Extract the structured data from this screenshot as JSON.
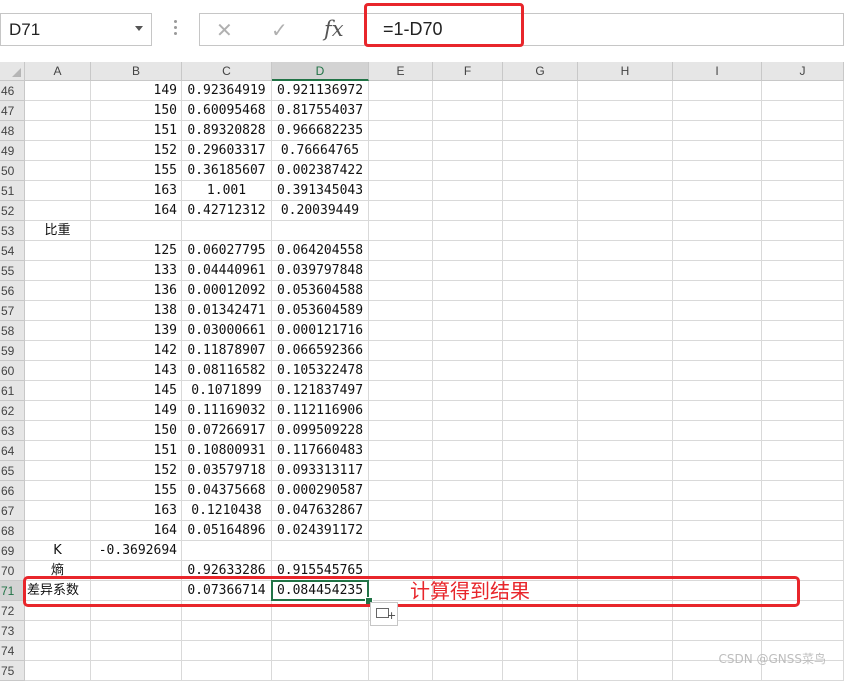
{
  "formula_bar": {
    "name_box": "D71",
    "cancel_glyph": "✕",
    "enter_glyph": "✓",
    "fx_label": "fx",
    "formula": "=1-D70"
  },
  "columns": [
    "A",
    "B",
    "C",
    "D",
    "E",
    "F",
    "G",
    "H",
    "I",
    "J"
  ],
  "selected_column": "D",
  "selected_row": "71",
  "rows": [
    {
      "n": "46",
      "a": "",
      "b": "149",
      "c": "0.92364919",
      "d": "0.921136972"
    },
    {
      "n": "47",
      "a": "",
      "b": "150",
      "c": "0.60095468",
      "d": "0.817554037"
    },
    {
      "n": "48",
      "a": "",
      "b": "151",
      "c": "0.89320828",
      "d": "0.966682235"
    },
    {
      "n": "49",
      "a": "",
      "b": "152",
      "c": "0.29603317",
      "d": "0.76664765"
    },
    {
      "n": "50",
      "a": "",
      "b": "155",
      "c": "0.36185607",
      "d": "0.002387422"
    },
    {
      "n": "51",
      "a": "",
      "b": "163",
      "c": "1.001",
      "d": "0.391345043"
    },
    {
      "n": "52",
      "a": "",
      "b": "164",
      "c": "0.42712312",
      "d": "0.20039449"
    },
    {
      "n": "53",
      "a": "比重",
      "b": "",
      "c": "",
      "d": ""
    },
    {
      "n": "54",
      "a": "",
      "b": "125",
      "c": "0.06027795",
      "d": "0.064204558"
    },
    {
      "n": "55",
      "a": "",
      "b": "133",
      "c": "0.04440961",
      "d": "0.039797848"
    },
    {
      "n": "56",
      "a": "",
      "b": "136",
      "c": "0.00012092",
      "d": "0.053604588"
    },
    {
      "n": "57",
      "a": "",
      "b": "138",
      "c": "0.01342471",
      "d": "0.053604589"
    },
    {
      "n": "58",
      "a": "",
      "b": "139",
      "c": "0.03000661",
      "d": "0.000121716"
    },
    {
      "n": "59",
      "a": "",
      "b": "142",
      "c": "0.11878907",
      "d": "0.066592366"
    },
    {
      "n": "60",
      "a": "",
      "b": "143",
      "c": "0.08116582",
      "d": "0.105322478"
    },
    {
      "n": "61",
      "a": "",
      "b": "145",
      "c": "0.1071899",
      "d": "0.121837497"
    },
    {
      "n": "62",
      "a": "",
      "b": "149",
      "c": "0.11169032",
      "d": "0.112116906"
    },
    {
      "n": "63",
      "a": "",
      "b": "150",
      "c": "0.07266917",
      "d": "0.099509228"
    },
    {
      "n": "64",
      "a": "",
      "b": "151",
      "c": "0.10800931",
      "d": "0.117660483"
    },
    {
      "n": "65",
      "a": "",
      "b": "152",
      "c": "0.03579718",
      "d": "0.093313117"
    },
    {
      "n": "66",
      "a": "",
      "b": "155",
      "c": "0.04375668",
      "d": "0.000290587"
    },
    {
      "n": "67",
      "a": "",
      "b": "163",
      "c": "0.1210438",
      "d": "0.047632867"
    },
    {
      "n": "68",
      "a": "",
      "b": "164",
      "c": "0.05164896",
      "d": "0.024391172"
    },
    {
      "n": "69",
      "a": "K",
      "b": "-0.3692694",
      "c": "",
      "d": ""
    },
    {
      "n": "70",
      "a": "熵",
      "b": "",
      "c": "0.92633286",
      "d": "0.915545765"
    },
    {
      "n": "71",
      "a": "差异系数",
      "b": "",
      "c": "0.07366714",
      "d": "0.084454235"
    },
    {
      "n": "72",
      "a": "",
      "b": "",
      "c": "",
      "d": ""
    },
    {
      "n": "73",
      "a": "",
      "b": "",
      "c": "",
      "d": ""
    },
    {
      "n": "74",
      "a": "",
      "b": "",
      "c": "",
      "d": ""
    },
    {
      "n": "75",
      "a": "",
      "b": "",
      "c": "",
      "d": ""
    }
  ],
  "annotation": "计算得到结果",
  "watermark": "CSDN @GNSS菜鸟",
  "colors": {
    "highlight": "#e8262b",
    "selection": "#217346"
  }
}
